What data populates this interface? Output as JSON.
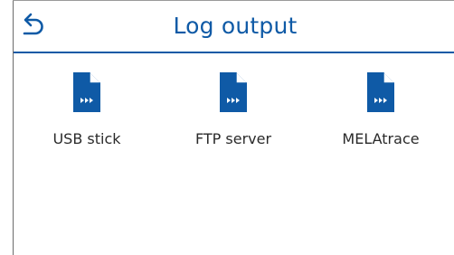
{
  "header": {
    "title": "Log output",
    "back_icon": "back-arrow-icon"
  },
  "options": [
    {
      "label": "USB stick",
      "icon": "document-forward-icon"
    },
    {
      "label": "FTP server",
      "icon": "document-forward-icon"
    },
    {
      "label": "MELAtrace",
      "icon": "document-forward-icon"
    }
  ],
  "colors": {
    "accent": "#0f5aa6",
    "text": "#2a2a2a",
    "background": "#ffffff"
  }
}
